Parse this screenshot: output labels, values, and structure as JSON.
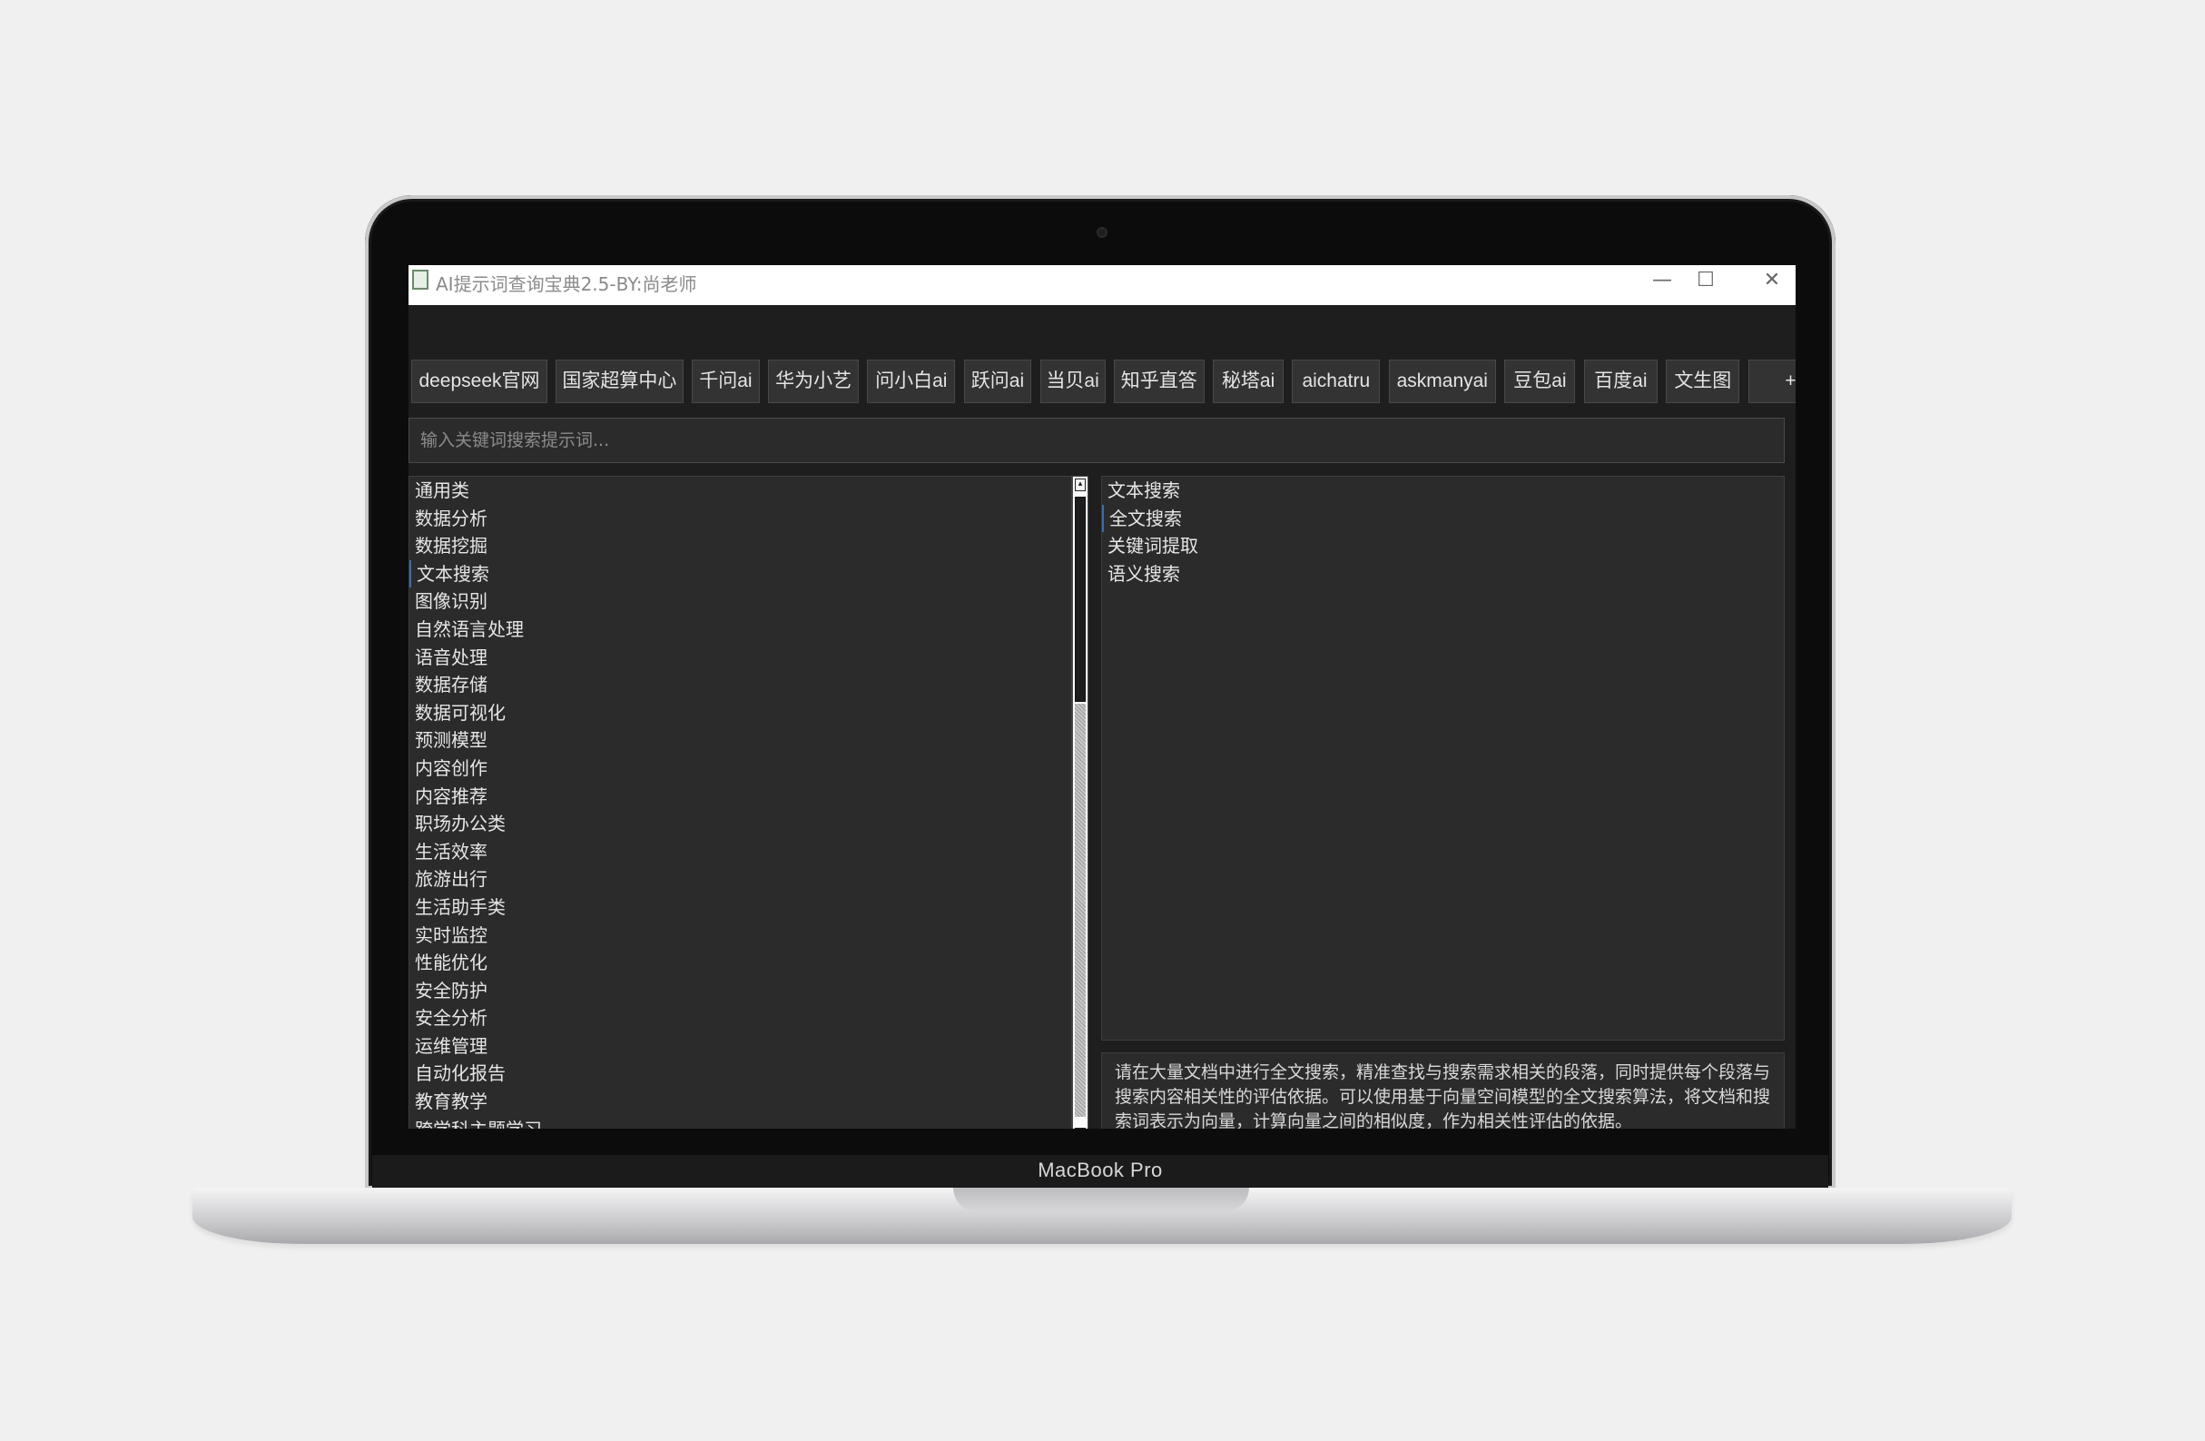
{
  "device": {
    "brand_label": "MacBook Pro"
  },
  "window": {
    "title": "AI提示词查询宝典2.5-BY:尚老师",
    "controls": {
      "minimize": "—",
      "maximize": "☐",
      "close": "✕"
    }
  },
  "toolbar": {
    "buttons": [
      "deepseek官网",
      "国家超算中心",
      "千问ai",
      "华为小艺",
      "问小白ai",
      "跃问ai",
      "当贝ai",
      "知乎直答",
      "秘塔ai",
      "aichatru",
      "askmanyai",
      "豆包ai",
      "百度ai",
      "文生图",
      "+"
    ]
  },
  "search": {
    "placeholder": "输入关键词搜索提示词..."
  },
  "categories": {
    "items": [
      "通用类",
      "数据分析",
      "数据挖掘",
      "文本搜索",
      "图像识别",
      "自然语言处理",
      "语音处理",
      "数据存储",
      "数据可视化",
      "预测模型",
      "内容创作",
      "内容推荐",
      "职场办公类",
      "生活效率",
      "旅游出行",
      "生活助手类",
      "实时监控",
      "性能优化",
      "安全防护",
      "安全分析",
      "运维管理",
      "自动化报告",
      "教育教学",
      "跨学科主题学习"
    ],
    "selected": "文本搜索"
  },
  "subcategories": {
    "items": [
      "文本搜索",
      "全文搜索",
      "关键词提取",
      "语义搜索"
    ],
    "selected": "全文搜索"
  },
  "description": {
    "text": "请在大量文档中进行全文搜索，精准查找与搜索需求相关的段落，同时提供每个段落与搜索内容相关性的评估依据。可以使用基于向量空间模型的全文搜索算法，将文档和搜索词表示为向量，计算向量之间的相似度，作为相关性评估的依据。"
  }
}
